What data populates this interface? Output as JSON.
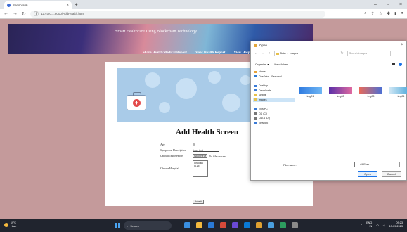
{
  "browser": {
    "tab_title": "Sensors66",
    "url": "127.0.0.1:8000/AddHealth.html"
  },
  "site": {
    "brand": "Smart Healthcare Using Blockchain Technology",
    "menu": [
      "Share Health/Medical Report",
      "View Health Report",
      "View Hospital"
    ]
  },
  "form": {
    "title": "Add Health Screen",
    "age_label": "Age",
    "age_value": "20",
    "symptom_label": "Symptoms Description",
    "symptom_value": "fever test",
    "upload_label": "Upload Test Reports",
    "choose_btn": "Choose File",
    "no_file": "No file chosen",
    "hospital_label": "Choose Hospital",
    "hospital_options": [
      "hospital1",
      "h1234"
    ],
    "submit_label": "Submit"
  },
  "dialog": {
    "title": "Open",
    "path": [
      "Data",
      "images"
    ],
    "search_placeholder": "Search images",
    "organize": "Organize ▾",
    "new_folder": "New folder",
    "tree": [
      {
        "label": "Home",
        "icon_color": "#e7a33b",
        "selected": false
      },
      {
        "label": "OneDrive - Personal",
        "icon_color": "#2f7bd6",
        "selected": false
      },
      {
        "label": "Desktop",
        "icon_color": "#3b7bd6",
        "selected": false
      },
      {
        "label": "Downloads",
        "icon_color": "#3b7bd6",
        "selected": false
      },
      {
        "label": "scripts",
        "icon_color": "#e7c04a",
        "selected": false
      },
      {
        "label": "images",
        "icon_color": "#e7c04a",
        "selected": true
      },
      {
        "label": "This PC",
        "icon_color": "#3b7bd6",
        "selected": false
      },
      {
        "label": "OS (C:)",
        "icon_color": "#777777",
        "selected": false
      },
      {
        "label": "DATA (D:)",
        "icon_color": "#777777",
        "selected": false
      },
      {
        "label": "Network",
        "icon_color": "#3b7bd6",
        "selected": false
      }
    ],
    "files": [
      {
        "name": "img01",
        "color_a": "#2f7be0",
        "color_b": "#6fb6f4"
      },
      {
        "name": "img02",
        "color_a": "#5a2fa8",
        "color_b": "#e06aa0"
      },
      {
        "name": "img03",
        "color_a": "#e86a5a",
        "color_b": "#4a6fd6"
      },
      {
        "name": "img04",
        "color_a": "#cfe6f4",
        "color_b": "#3aa0d6"
      }
    ],
    "filename_label": "File name:",
    "filetype": "All Files",
    "open_btn": "Open",
    "cancel_btn": "Cancel"
  },
  "taskbar": {
    "weather_temp": "19°C",
    "weather_desc": "Haze",
    "search_label": "Search",
    "apps": [
      "#3a8fe0",
      "#f4b93e",
      "#2a7ad6",
      "#d64a3a",
      "#6b4ad6",
      "#0a7ad6",
      "#e0a030",
      "#4aa0e0",
      "#2d9d5f",
      "#8a8a8a"
    ],
    "lang": "ENG",
    "region": "IN",
    "time": "09:23",
    "date": "13-09-2023"
  }
}
